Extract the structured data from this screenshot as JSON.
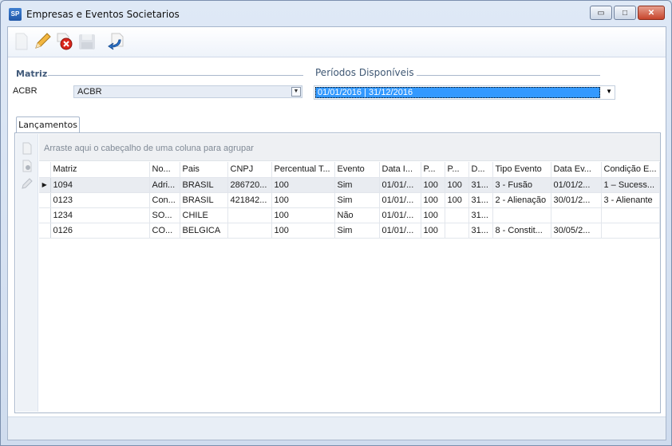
{
  "window": {
    "title": "Empresas e Eventos Societarios",
    "icon_text": "SP",
    "minimize_glyph": "▭",
    "maximize_glyph": "□",
    "close_glyph": "✕"
  },
  "toolbar": {
    "buttons": [
      {
        "name": "new-icon",
        "enabled": false
      },
      {
        "name": "edit-icon",
        "enabled": true
      },
      {
        "name": "delete-icon",
        "enabled": true
      },
      {
        "name": "save-icon",
        "enabled": false
      },
      {
        "name": "undo-icon",
        "enabled": true
      }
    ]
  },
  "matriz": {
    "label": "Matriz",
    "code": "ACBR",
    "name": "ACBR",
    "arrow": "▼"
  },
  "periodos": {
    "label": "Períodos Disponíveis",
    "selected": "01/01/2016 | 31/12/2016",
    "arrow": "▼"
  },
  "tabs": [
    {
      "label": "Lançamentos"
    }
  ],
  "grid": {
    "group_hint": "Arraste aqui o cabeçalho de uma coluna para agrupar",
    "columns": [
      "Matriz",
      "No...",
      "Pais",
      "CNPJ",
      "Percentual T...",
      "Evento",
      "Data I...",
      "P...",
      "P...",
      "D...",
      "Tipo Evento",
      "Data Ev...",
      "Condição E..."
    ],
    "rows": [
      {
        "selected": true,
        "indicator": "▶",
        "cells": [
          "1094",
          "Adri...",
          "BRASIL",
          "286720...",
          "100",
          "Sim",
          "01/01/...",
          "100",
          "100",
          "31...",
          "3 - Fusão",
          "01/01/2...",
          "1 – Sucess..."
        ]
      },
      {
        "selected": false,
        "indicator": "",
        "cells": [
          "0123",
          "Con...",
          "BRASIL",
          "421842...",
          "100",
          "Sim",
          "01/01/...",
          "100",
          "100",
          "31...",
          "2 - Alienação",
          "30/01/2...",
          "3 - Alienante"
        ]
      },
      {
        "selected": false,
        "indicator": "",
        "cells": [
          "1234",
          "SO...",
          "CHILE",
          "",
          "100",
          "Não",
          "01/01/...",
          "100",
          "",
          "31...",
          "",
          "",
          ""
        ]
      },
      {
        "selected": false,
        "indicator": "",
        "cells": [
          "0126",
          "CO...",
          "BELGICA",
          "",
          "100",
          "Sim",
          "01/01/...",
          "100",
          "",
          "31...",
          "8 - Constit...",
          "30/05/2...",
          ""
        ]
      }
    ]
  }
}
